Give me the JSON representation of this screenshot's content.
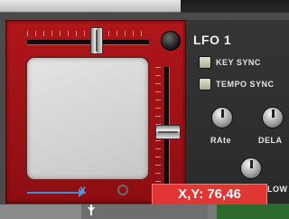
{
  "lfo": {
    "title": "LFO 1",
    "key_sync_label": "KEY SYNC",
    "tempo_sync_label": "TEMPO SYNC",
    "rate_label": "RAte",
    "delay_label": "DELA",
    "slow_label": "LOW"
  },
  "xy_pad": {
    "x_axis_label": "X",
    "readout": "X,Y: 76,46",
    "x_value": 76,
    "y_value": 46
  },
  "colors": {
    "panel_red": "#b0161a",
    "readout_red": "#e03634",
    "axis_blue": "#3d8fd8"
  },
  "icons": {
    "pad_dot": "circle-marker-icon",
    "status_lamp": "lamp-icon",
    "marker": "pin-icon"
  }
}
